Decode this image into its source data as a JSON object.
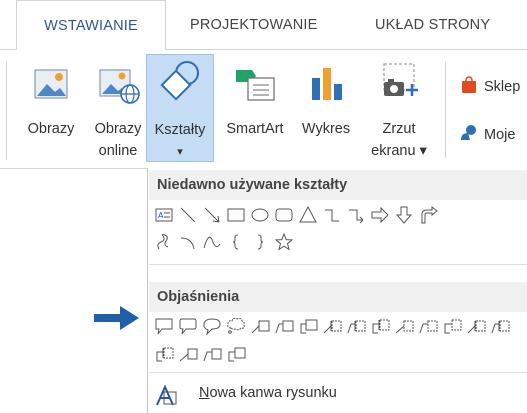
{
  "tabs": [
    {
      "label": "WSTAWIANIE",
      "active": true
    },
    {
      "label": "PROJEKTOWANIE",
      "active": false
    },
    {
      "label": "UKŁAD STRONY",
      "active": false
    }
  ],
  "ribbon": {
    "buttons": [
      {
        "line1": "Obrazy",
        "line2": "",
        "icon": "image-icon"
      },
      {
        "line1": "Obrazy",
        "line2": "online",
        "icon": "online-image-icon"
      },
      {
        "line1": "Kształty",
        "line2": "▾",
        "icon": "shapes-icon",
        "selected": true
      },
      {
        "line1": "SmartArt",
        "line2": "",
        "icon": "smartart-icon"
      },
      {
        "line1": "Wykres",
        "line2": "",
        "icon": "chart-icon"
      },
      {
        "line1": "Zrzut",
        "line2": "ekranu ▾",
        "icon": "screenshot-icon"
      }
    ],
    "small": [
      {
        "label": "Sklep",
        "icon": "store-icon"
      },
      {
        "label": "Moje",
        "icon": "my-apps-icon"
      }
    ]
  },
  "dropdown": {
    "recent_header": "Niedawno używane kształty",
    "callouts_header": "Objaśnienia",
    "new_canvas_first": "N",
    "new_canvas_rest": "owa kanwa rysunku"
  },
  "colors": {
    "accent": "#2b579a",
    "selected_bg": "#c5dcf5",
    "arrow": "#1f5ea8",
    "header_bg": "#f0f0f0"
  }
}
